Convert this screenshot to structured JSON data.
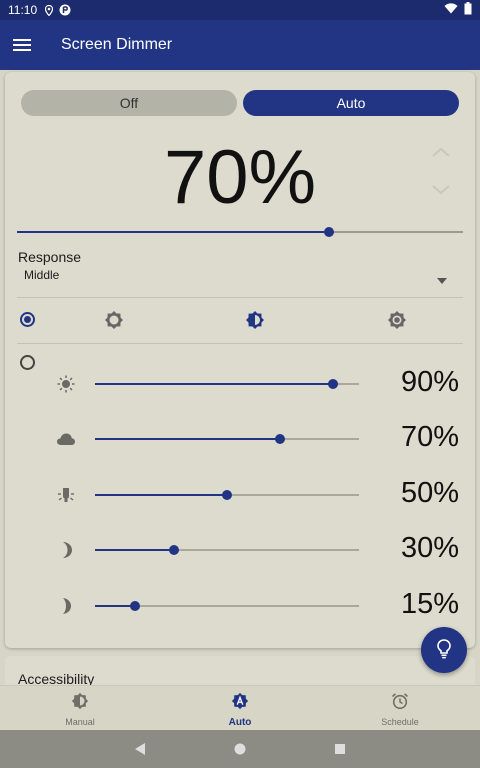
{
  "status_bar": {
    "time": "11:10",
    "icons": [
      "location-icon",
      "app-notification-icon",
      "wifi-icon",
      "battery-icon"
    ]
  },
  "app_bar": {
    "title": "Screen Dimmer",
    "menu_icon": "menu-icon"
  },
  "mode_toggle": {
    "off_label": "Off",
    "auto_label": "Auto",
    "selected": "Auto"
  },
  "main_level": {
    "value_text": "70%",
    "slider_fraction": 0.7
  },
  "response": {
    "label": "Response",
    "value": "Middle"
  },
  "auto_modes": {
    "selected_index": 0,
    "icons": [
      "brightness-low-icon",
      "brightness-half-icon",
      "brightness-high-icon"
    ]
  },
  "custom_levels": [
    {
      "icon": "sun-icon",
      "fraction": 0.9,
      "value_text": "90%"
    },
    {
      "icon": "cloud-icon",
      "fraction": 0.7,
      "value_text": "70%"
    },
    {
      "icon": "lamp-icon",
      "fraction": 0.5,
      "value_text": "50%"
    },
    {
      "icon": "moon-icon",
      "fraction": 0.3,
      "value_text": "30%"
    },
    {
      "icon": "crescent-moon-icon",
      "fraction": 0.15,
      "value_text": "15%"
    }
  ],
  "accessibility": {
    "title": "Accessibility"
  },
  "bottom_nav": {
    "items": [
      {
        "label": "Manual",
        "icon": "brightness-manual-icon"
      },
      {
        "label": "Auto",
        "icon": "brightness-auto-icon"
      },
      {
        "label": "Schedule",
        "icon": "alarm-clock-icon"
      }
    ],
    "active": "Auto"
  },
  "colors": {
    "primary": "#223584",
    "background": "#d6d5c6",
    "card": "#dcdbcd"
  }
}
